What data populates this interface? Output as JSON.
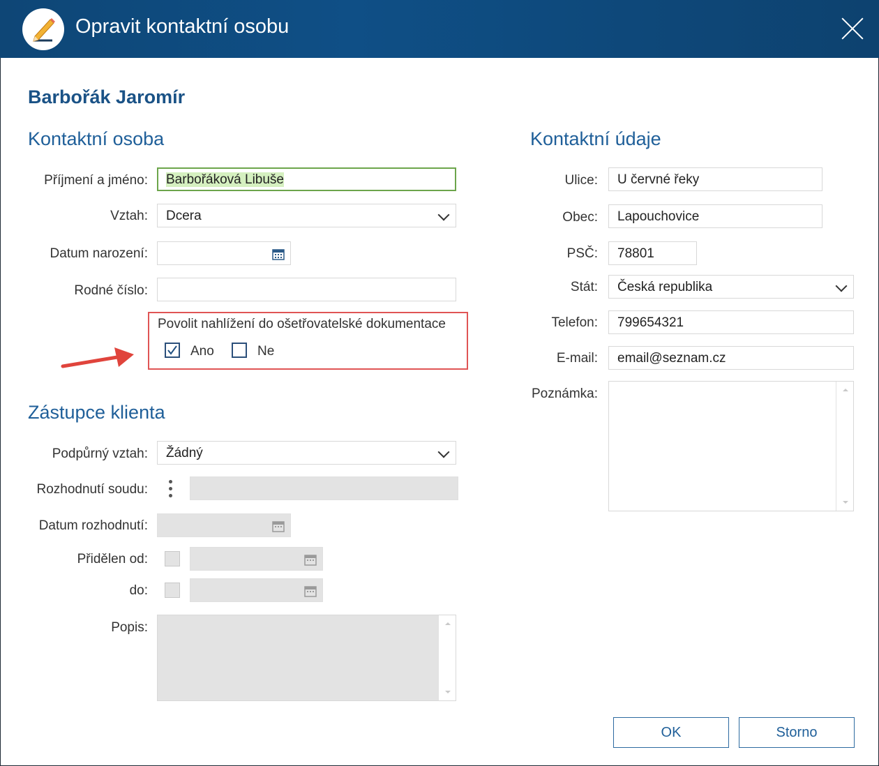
{
  "window": {
    "title": "Opravit kontaktní osobu",
    "accent": "#0f4f86"
  },
  "client_name": "Barbořák Jaromír",
  "contact_person": {
    "section_title": "Kontaktní osoba",
    "surname_label": "Příjmení a jméno:",
    "surname_value": "Barbořáková Libuše",
    "relation_label": "Vztah:",
    "relation_value": "Dcera",
    "birthdate_label": "Datum narození:",
    "birthdate_value": "",
    "birth_number_label": "Rodné číslo:",
    "birth_number_value": "",
    "permission_label": "Povolit nahlížení do ošetřovatelské dokumentace",
    "yes_label": "Ano",
    "yes_checked": true,
    "no_label": "Ne",
    "no_checked": false
  },
  "representative": {
    "section_title": "Zástupce klienta",
    "support_label": "Podpůrný vztah:",
    "support_value": "Žádný",
    "court_decision_label": "Rozhodnutí soudu:",
    "decision_date_label": "Datum rozhodnutí:",
    "assigned_from_label": "Přidělen od:",
    "assigned_to_label": "do:",
    "description_label": "Popis:"
  },
  "contact_info": {
    "section_title": "Kontaktní údaje",
    "street_label": "Ulice:",
    "street_value": "U červné řeky",
    "city_label": "Obec:",
    "city_value": "Lapouchovice",
    "zip_label": "PSČ:",
    "zip_value": "78801",
    "country_label": "Stát:",
    "country_value": "Česká republika",
    "phone_label": "Telefon:",
    "phone_value": "799654321",
    "email_label": "E-mail:",
    "email_value": "email@seznam.cz",
    "note_label": "Poznámka:"
  },
  "buttons": {
    "ok": "OK",
    "cancel": "Storno"
  },
  "icons": [
    "pencil-icon",
    "close-icon",
    "calendar-icon",
    "chevron-down-icon",
    "checkmark-icon",
    "vertical-dots-icon",
    "red-arrow-icon"
  ]
}
